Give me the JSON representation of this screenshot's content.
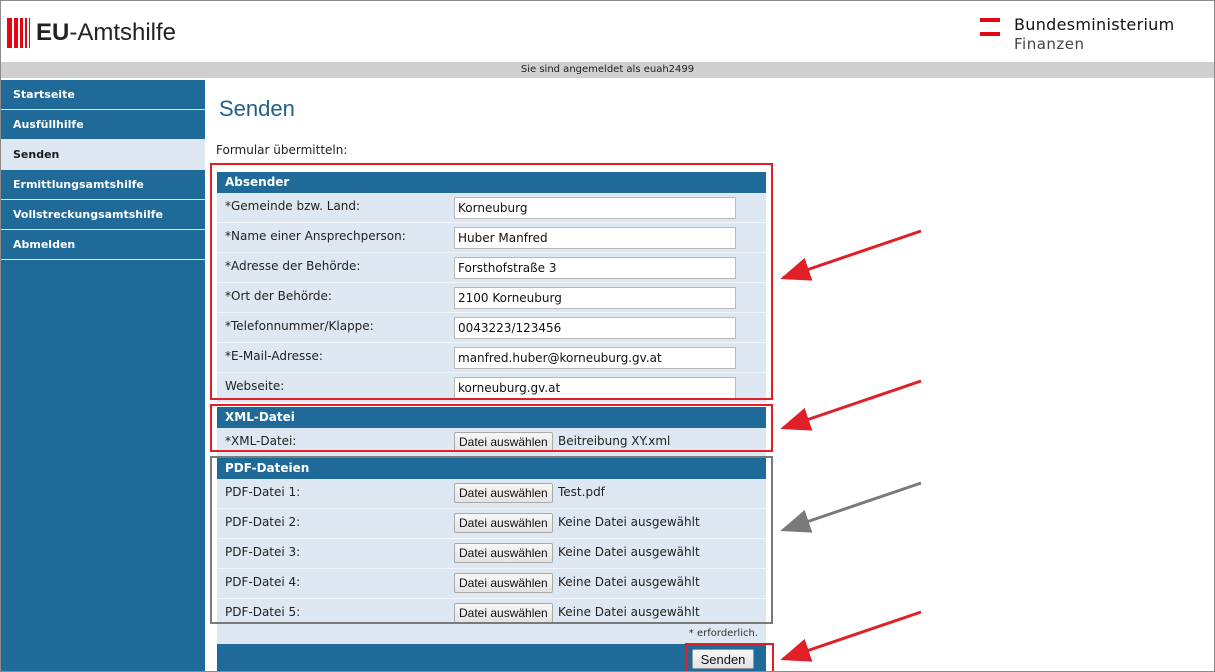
{
  "header": {
    "app_title_bold": "EU",
    "app_title_rest": "-Amtshilfe",
    "ministry_line1": "Bundesministerium",
    "ministry_line2": "Finanzen"
  },
  "login_status": "Sie sind angemeldet als euah2499",
  "sidebar": {
    "items": [
      {
        "label": "Startseite",
        "active": false
      },
      {
        "label": "Ausfüllhilfe",
        "active": false
      },
      {
        "label": "Senden",
        "active": true
      },
      {
        "label": "Ermittlungsamtshilfe",
        "active": false
      },
      {
        "label": "Vollstreckungsamtshilfe",
        "active": false
      },
      {
        "label": "Abmelden",
        "active": false
      }
    ]
  },
  "main": {
    "title": "Senden",
    "intro": "Formular übermitteln:",
    "sender": {
      "heading": "Absender",
      "fields": [
        {
          "label": "*Gemeinde bzw. Land:",
          "value": "Korneuburg"
        },
        {
          "label": "*Name einer Ansprechperson:",
          "value": "Huber Manfred"
        },
        {
          "label": "*Adresse der Behörde:",
          "value": "Forsthofstraße 3"
        },
        {
          "label": "*Ort der Behörde:",
          "value": "2100 Korneuburg"
        },
        {
          "label": "*Telefonnummer/Klappe:",
          "value": "0043223/123456"
        },
        {
          "label": "*E-Mail-Adresse:",
          "value": "manfred.huber@korneuburg.gv.at"
        },
        {
          "label": "Webseite:",
          "value": "korneuburg.gv.at"
        }
      ]
    },
    "xml": {
      "heading": "XML-Datei",
      "label": "*XML-Datei:",
      "button": "Datei auswählen",
      "filename": "Beitreibung XY.xml"
    },
    "pdf": {
      "heading": "PDF-Dateien",
      "button": "Datei auswählen",
      "files": [
        {
          "label": "PDF-Datei 1:",
          "filename": "Test.pdf"
        },
        {
          "label": "PDF-Datei 2:",
          "filename": "Keine Datei ausgewählt"
        },
        {
          "label": "PDF-Datei 3:",
          "filename": "Keine Datei ausgewählt"
        },
        {
          "label": "PDF-Datei 4:",
          "filename": "Keine Datei ausgewählt"
        },
        {
          "label": "PDF-Datei 5:",
          "filename": "Keine Datei ausgewählt"
        }
      ]
    },
    "required_note": "* erforderlich.",
    "send_label": "Senden"
  },
  "colors": {
    "accent_blue": "#1f6a99",
    "light_blue": "#dde8f2",
    "highlight_red": "#e01f26",
    "highlight_gray": "#7a7a7a"
  }
}
